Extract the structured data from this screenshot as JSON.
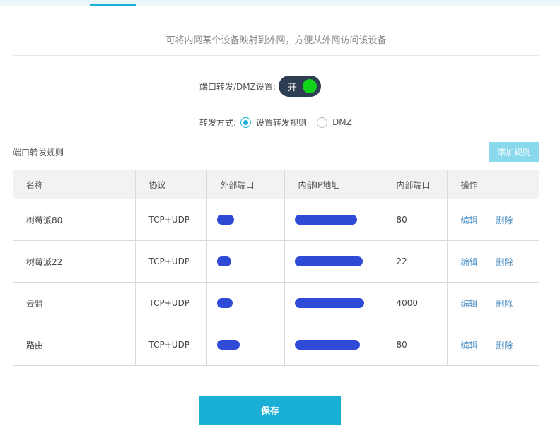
{
  "header": {
    "description": "可将内网某个设备映射到外网，方便从外网访问该设备"
  },
  "settings": {
    "toggle_label": "端口转发/DMZ设置:",
    "toggle_state": "开",
    "toggle_on": true,
    "mode_label": "转发方式:",
    "mode_options": [
      {
        "label": "设置转发规则",
        "selected": true
      },
      {
        "label": "DMZ",
        "selected": false
      }
    ]
  },
  "rules": {
    "section_title": "端口转发规则",
    "add_button": "添加规则",
    "columns": [
      "名称",
      "协议",
      "外部端口",
      "内部IP地址",
      "内部端口",
      "操作"
    ],
    "rows": [
      {
        "name": "树莓派80",
        "protocol": "TCP+UDP",
        "internal_port": "80"
      },
      {
        "name": "树莓派22",
        "protocol": "TCP+UDP",
        "internal_port": "22"
      },
      {
        "name": "云监",
        "protocol": "TCP+UDP",
        "internal_port": "4000"
      },
      {
        "name": "路由",
        "protocol": "TCP+UDP",
        "internal_port": "80"
      }
    ],
    "edit_label": "编辑",
    "delete_label": "删除"
  },
  "footer": {
    "save_button": "保存"
  },
  "colors": {
    "accent": "#1ab0d6",
    "toggle_bg": "#2e3e52",
    "toggle_knob": "#10d41a",
    "link": "#4c8fc4",
    "redaction": "#2f4ad6"
  },
  "icons": {
    "radio_selected": "radio-checked-icon",
    "radio_unselected": "radio-empty-icon"
  }
}
